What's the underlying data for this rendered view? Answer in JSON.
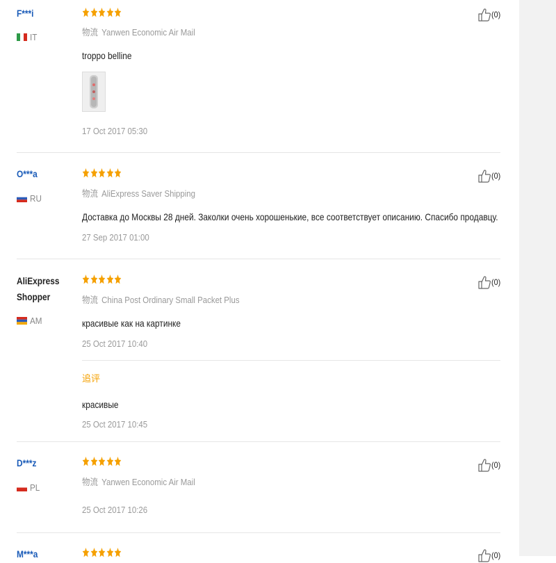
{
  "reviews": [
    {
      "user": "F***i",
      "country": "IT",
      "stars": 5,
      "shipping_label": "物流",
      "shipping": "Yanwen Economic Air Mail",
      "content": "troppo belline",
      "date": "17 Oct 2017 05:30",
      "likes": "(0)"
    },
    {
      "user": "O***a",
      "country": "RU",
      "stars": 5,
      "shipping_label": "物流",
      "shipping": "AliExpress Saver Shipping",
      "content": "Доставка до Москвы 28 дней. Заколки очень хорошенькие, все соответствует описанию. Спасибо продавцу.",
      "date": "27 Sep 2017 01:00",
      "likes": "(0)"
    },
    {
      "user_line1": "AliExpress",
      "user_line2": "Shopper",
      "country": "AM",
      "stars": 5,
      "shipping_label": "物流",
      "shipping": "China Post Ordinary Small Packet Plus",
      "content": "красивые как на картинке",
      "date": "25 Oct 2017 10:40",
      "followup_label": "追评",
      "followup_content": "красивые",
      "followup_date": "25 Oct 2017 10:45",
      "likes": "(0)"
    },
    {
      "user": "D***z",
      "country": "PL",
      "stars": 5,
      "shipping_label": "物流",
      "shipping": "Yanwen Economic Air Mail",
      "date": "25 Oct 2017 10:26",
      "likes": "(0)"
    },
    {
      "user": "M***a",
      "stars": 5,
      "likes": "(0)"
    }
  ],
  "colors": {
    "star": "#f5a000",
    "username": "#1a5bb8",
    "followup": "#f5a000"
  }
}
